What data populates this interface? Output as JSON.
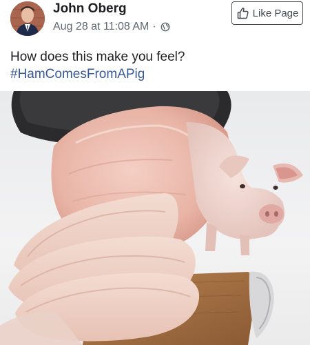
{
  "post": {
    "author": {
      "name": "John Oberg"
    },
    "meta": {
      "timestamp": "Aug 28 at 11:08 AM",
      "separator": "·",
      "audience_icon": "globe-icon"
    },
    "like_page_button": {
      "label": "Like Page",
      "icon": "thumbs-up-icon"
    },
    "caption": {
      "text": "How does this make you feel?",
      "hashtag": "#HamComesFromAPig"
    }
  },
  "colors": {
    "name_text": "#1c1e21",
    "meta_text": "#606770",
    "hashtag": "#365899",
    "button_border": "#444950"
  }
}
